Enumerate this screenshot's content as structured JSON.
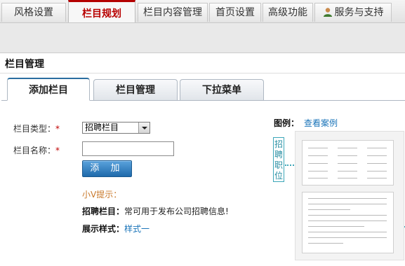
{
  "top_tabs": [
    {
      "label": "风格设置",
      "active": false
    },
    {
      "label": "栏目规划",
      "active": true
    },
    {
      "label": "栏目内容管理",
      "active": false
    },
    {
      "label": "首页设置",
      "active": false
    },
    {
      "label": "高级功能",
      "active": false
    },
    {
      "label": "服务与支持",
      "active": false,
      "icon": "user-icon"
    }
  ],
  "section": {
    "title": "栏目管理"
  },
  "sub_tabs": [
    {
      "label": "添加栏目",
      "active": true
    },
    {
      "label": "栏目管理",
      "active": false
    },
    {
      "label": "下拉菜单",
      "active": false
    }
  ],
  "form": {
    "type_label": "栏目类型：",
    "required_mark": "*",
    "type_value": "招聘栏目",
    "name_label": "栏目名称：",
    "name_value": "",
    "add_button": "添 加"
  },
  "tips": {
    "title": "小V提示：",
    "line1_key": "招聘栏目：",
    "line1_value": "常可用于发布公司招聘信息!",
    "line2_key": "展示样式：",
    "line2_value": "样式一"
  },
  "example": {
    "label": "图例：",
    "link": "查看案例",
    "tag": "招聘职位"
  },
  "colors": {
    "active_tab": "#b80000",
    "link": "#1a74b9",
    "tip": "#c8782a",
    "button": "#1f6aab",
    "tag": "#3ba6b8"
  }
}
